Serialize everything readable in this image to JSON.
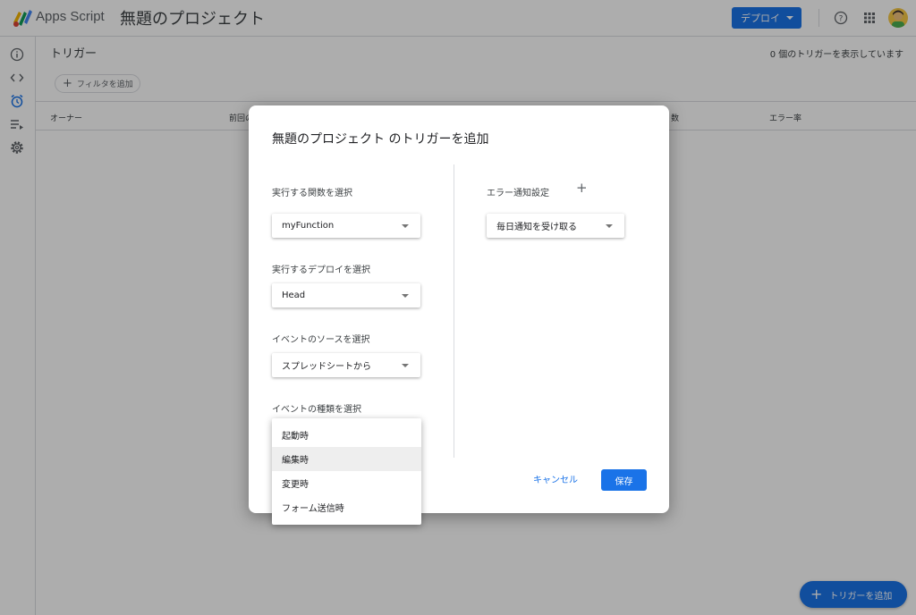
{
  "topbar": {
    "app_name": "Apps Script",
    "project_name": "無題のプロジェクト",
    "deploy_label": "デプロイ"
  },
  "page": {
    "title": "トリガー",
    "trigger_count_text": "0 個のトリガーを表示しています",
    "filter_label": "フィルタを追加",
    "columns": [
      "オーナー",
      "前回の",
      "数",
      "エラー率"
    ],
    "fab_label": "トリガーを追加"
  },
  "dialog": {
    "title": "無題のプロジェクト のトリガーを追加",
    "function_label": "実行する関数を選択",
    "function_value": "myFunction",
    "deploy_label": "実行するデプロイを選択",
    "deploy_value": "Head",
    "source_label": "イベントのソースを選択",
    "source_value": "スプレッドシートから",
    "event_type_label": "イベントの種類を選択",
    "error_label": "エラー通知設定",
    "error_value": "毎日通知を受け取る",
    "cancel_label": "キャンセル",
    "save_label": "保存"
  },
  "event_menu": {
    "items": [
      "起動時",
      "編集時",
      "変更時",
      "フォーム送信時"
    ],
    "highlighted": "編集時"
  },
  "colors": {
    "accent": "#1a73e8"
  },
  "icons": [
    "apps-script-logo",
    "help-icon",
    "apps-grid-icon",
    "info-icon",
    "code-icon",
    "alarm-icon",
    "executions-icon",
    "settings-icon",
    "plus-icon",
    "chevron-down-icon"
  ]
}
